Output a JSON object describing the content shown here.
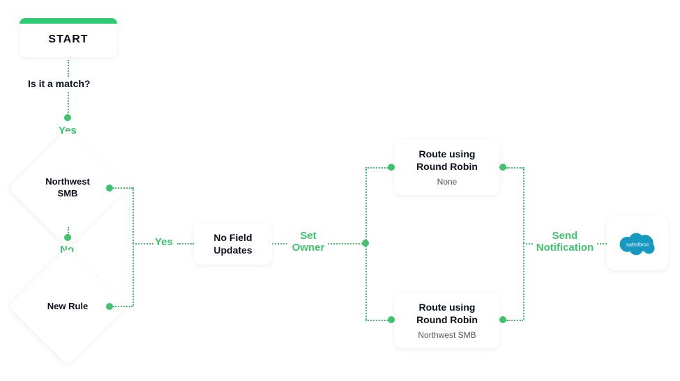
{
  "start": {
    "label": "START"
  },
  "question": "Is it a match?",
  "labels": {
    "yes1": "Yes",
    "no": "No",
    "yes2": "Yes",
    "set_owner": "Set Owner",
    "send_notification": "Send Notification"
  },
  "diamonds": {
    "northwest_smb": "Northwest SMB",
    "new_rule": "New Rule"
  },
  "nodes": {
    "no_field_updates": "No Field Updates",
    "route_top": {
      "title": "Route using Round Robin",
      "sub": "None"
    },
    "route_bottom": {
      "title": "Route using Round Robin",
      "sub": "Northwest SMB"
    }
  },
  "icons": {
    "salesforce": "salesforce"
  },
  "colors": {
    "accent": "#3fc46d",
    "sf_blue": "#1798c1"
  }
}
